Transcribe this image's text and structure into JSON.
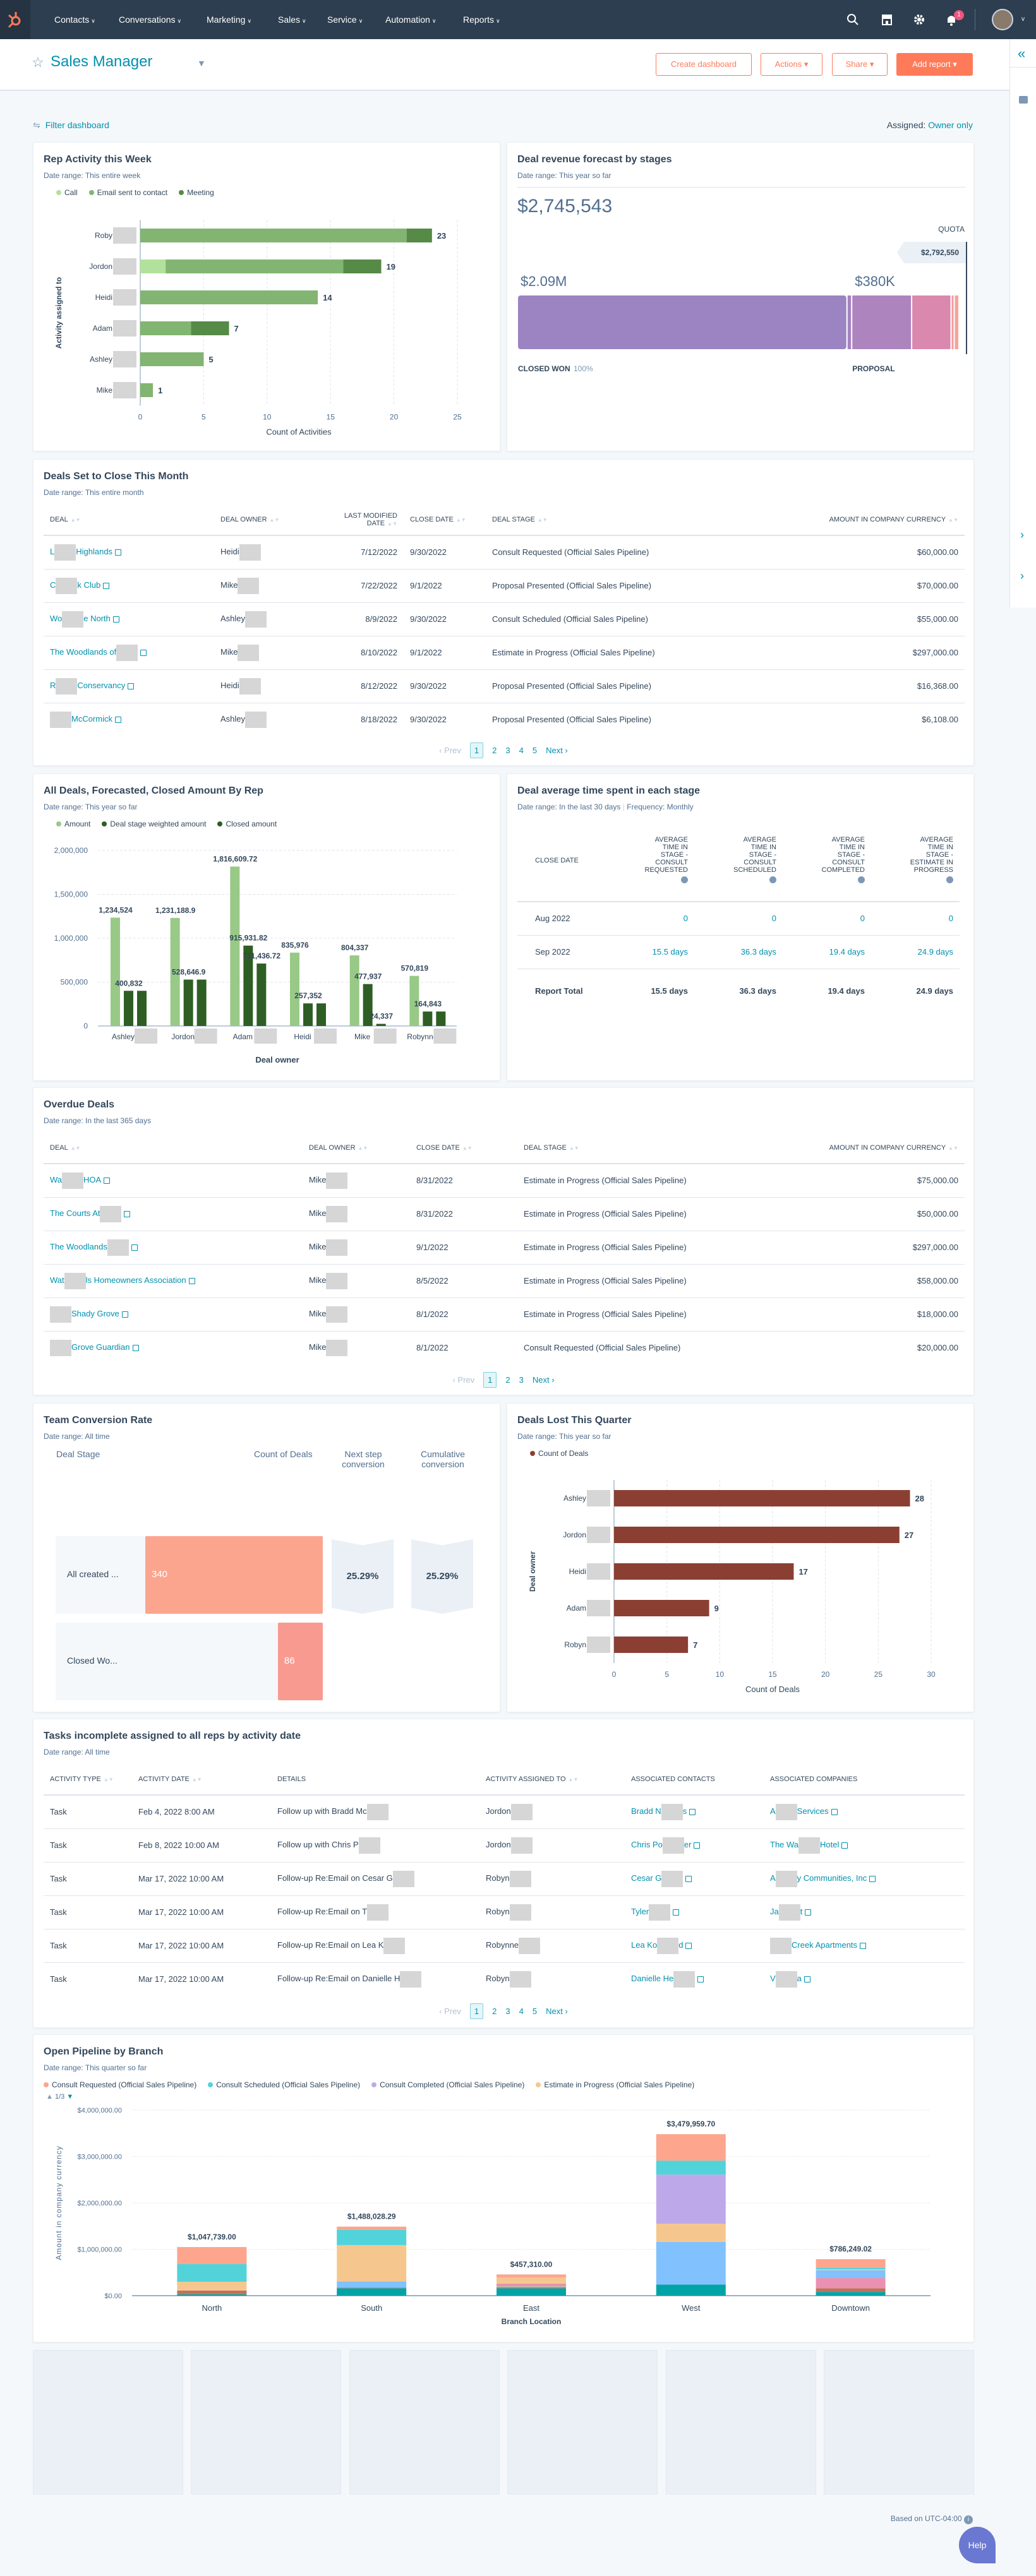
{
  "nav": {
    "items": [
      "Contacts",
      "Conversations",
      "Marketing",
      "Sales",
      "Service",
      "Automation",
      "Reports"
    ],
    "notification_count": "1",
    "icons": [
      "search-icon",
      "marketplace-icon",
      "gear-icon",
      "bell-icon",
      "avatar"
    ]
  },
  "header": {
    "title": "Sales Manager",
    "create_dashboard": "Create dashboard",
    "actions": "Actions",
    "share": "Share",
    "add_report": "Add report"
  },
  "filter": {
    "label": "Filter dashboard",
    "assigned_label": "Assigned:",
    "assigned_value": "Owner only"
  },
  "colors": {
    "nav": "#2d3e50",
    "accent": "#0091ae",
    "button": "#ff7a59"
  },
  "chart_data": [
    {
      "type": "bar",
      "orientation": "horizontal",
      "stacked": true,
      "title": "Rep Activity this Week",
      "subtitle": "Date range: This entire week",
      "categories": [
        "Roby",
        "Jordon",
        "Heidi",
        "Adam",
        "Ashley",
        "Mike"
      ],
      "series": [
        {
          "name": "Call",
          "color": "#b2e19b",
          "values": [
            0,
            2,
            0,
            0,
            0,
            0
          ]
        },
        {
          "name": "Email sent to contact",
          "color": "#82b571",
          "values": [
            21,
            14,
            14,
            4,
            5,
            1
          ]
        },
        {
          "name": "Meeting",
          "color": "#568a47",
          "values": [
            2,
            3,
            0,
            3,
            0,
            0
          ]
        }
      ],
      "totals": [
        "23",
        "19",
        "14",
        "7",
        "5",
        "1"
      ],
      "xlabel": "Count of Activities",
      "ylabel": "Activity assigned to",
      "xlim": [
        0,
        25
      ],
      "xticks": [
        "0",
        "5",
        "10",
        "15",
        "20",
        "25"
      ],
      "grid": true,
      "legend": "top-left"
    },
    {
      "type": "bar",
      "orientation": "vertical",
      "title": "All Deals, Forecasted, Closed Amount By Rep",
      "subtitle": "Date range: This year so far",
      "categories": [
        "Ashley",
        "Jordon",
        "Adam",
        "Heidi",
        "Mike",
        "Robynne"
      ],
      "series": [
        {
          "name": "Amount",
          "color": "#98c987",
          "values": [
            1234524,
            1231188.9,
            1816609.72,
            835976,
            804337,
            570819
          ],
          "labels": [
            "1,234,524",
            "1,231,188.9",
            "1,816,609.72",
            "835,976",
            "804,337",
            "570,819"
          ]
        },
        {
          "name": "Deal stage weighted amount",
          "color": "#2e5e24",
          "values": [
            400832,
            528646.9,
            915931.82,
            257352,
            477937,
            164843
          ],
          "labels": [
            "400,832",
            "528,646.9",
            "915,931.82",
            "257,352",
            "477,937",
            "164,843"
          ]
        },
        {
          "name": "Closed amount",
          "color": "#2e5e24",
          "values": [
            400832,
            528646.9,
            711436.72,
            257352,
            24337,
            164843
          ],
          "labels": [
            "",
            "",
            "711,436.72",
            "",
            "24,337",
            ""
          ]
        }
      ],
      "xlabel": "Deal owner",
      "ylim": [
        0,
        2000000
      ],
      "yticks": [
        "0",
        "500,000",
        "1,000,000",
        "1,500,000",
        "2,000,000"
      ],
      "grid": true,
      "legend": "top-left"
    },
    {
      "type": "bar",
      "orientation": "horizontal",
      "title": "Deals Lost This Quarter",
      "subtitle": "Date range: This year so far",
      "categories": [
        "Ashley",
        "Jordon",
        "Heidi",
        "Adam",
        "Robyn"
      ],
      "series": [
        {
          "name": "Count of Deals",
          "color": "#8b3f33",
          "values": [
            28,
            27,
            17,
            9,
            7
          ]
        }
      ],
      "xlabel": "Count of Deals",
      "ylabel": "Deal owner",
      "xlim": [
        0,
        30
      ],
      "xticks": [
        "0",
        "5",
        "10",
        "15",
        "20",
        "25",
        "30"
      ],
      "grid": true,
      "legend": "top-left"
    },
    {
      "type": "bar",
      "orientation": "vertical",
      "stacked": true,
      "title": "Open Pipeline by Branch",
      "subtitle": "Date range: This quarter so far",
      "legend_page": "1/3",
      "categories": [
        "North",
        "South",
        "East",
        "West",
        "Downtown"
      ],
      "totals": [
        "$1,047,739.00",
        "$1,488,028.29",
        "$457,310.00",
        "$3,479,959.70",
        "$786,249.02"
      ],
      "series": [
        {
          "color": "#00a4a6",
          "values": [
            30000,
            160000,
            160000,
            240000,
            80000
          ]
        },
        {
          "color": "#c2705c",
          "values": [
            80000,
            10000,
            20000,
            0,
            80000
          ]
        },
        {
          "color": "#a2c08c",
          "values": [
            0,
            0,
            20000,
            0,
            0
          ]
        },
        {
          "color": "#ea90b1",
          "values": [
            0,
            0,
            60000,
            0,
            220000
          ]
        },
        {
          "color": "#81c1fd",
          "values": [
            0,
            140000,
            0,
            920000,
            170000
          ]
        },
        {
          "name": "Estimate in Progress (Official Sales Pipeline)",
          "color": "#f5c78e",
          "values": [
            190000,
            780000,
            130000,
            390000,
            20000
          ]
        },
        {
          "name": "Consult Completed (Official Sales Pipeline)",
          "color": "#bda9ea",
          "values": [
            0,
            0,
            0,
            1060000,
            0
          ]
        },
        {
          "name": "Consult Scheduled (Official Sales Pipeline)",
          "color": "#51d3d9",
          "values": [
            380000,
            330000,
            0,
            300000,
            30000
          ]
        },
        {
          "name": "Consult Requested (Official Sales Pipeline)",
          "color": "#fea58e",
          "values": [
            367739,
            68028.29,
            67310,
            569959.7,
            186249.02
          ]
        }
      ],
      "xlabel": "Branch Location",
      "ylabel": "Amount in company currency",
      "ylim": [
        0,
        4000000
      ],
      "yticks": [
        "$0.00",
        "$1,000,000.00",
        "$2,000,000.00",
        "$3,000,000.00",
        "$4,000,000.00"
      ],
      "grid": true,
      "legend": "top-left"
    }
  ],
  "forecast": {
    "title": "Deal revenue forecast by stages",
    "subtitle": "Date range: This year so far",
    "total": "$2,745,543",
    "quota_label": "QUOTA",
    "quota": "$2,792,550",
    "segments": [
      {
        "value": 2090000,
        "color": "#9b84c1",
        "amount": "$2.09M",
        "stage": "CLOSED WON",
        "pct": "100%"
      },
      {
        "value": 30000,
        "color": "#a584c0"
      },
      {
        "value": 380000,
        "color": "#ad84bd",
        "amount": "$380K",
        "stage": "PROPOSAL"
      },
      {
        "value": 250000,
        "color": "#da88ae"
      },
      {
        "value": 20000,
        "color": "#f59a9a"
      },
      {
        "value": 30000,
        "color": "#f8a39a"
      }
    ]
  },
  "deals_close": {
    "title": "Deals Set to Close This Month",
    "subtitle": "Date range: This entire month",
    "headers": [
      "Deal",
      "Deal owner",
      "Last modified date",
      "Close date",
      "Deal stage",
      "Amount in company currency"
    ],
    "rows": [
      [
        {
          "pre": "L",
          "post": "Highlands"
        },
        {
          "pre": "Heidi"
        },
        "7/12/2022",
        "9/30/2022",
        "Consult Requested (Official Sales Pipeline)",
        "$60,000.00"
      ],
      [
        {
          "pre": "C",
          "post": "k Club"
        },
        {
          "pre": "Mike"
        },
        "7/22/2022",
        "9/1/2022",
        "Proposal Presented (Official Sales Pipeline)",
        "$70,000.00"
      ],
      [
        {
          "pre": "Wo",
          "post": "e North"
        },
        {
          "pre": "Ashley"
        },
        "8/9/2022",
        "9/30/2022",
        "Consult Scheduled (Official Sales Pipeline)",
        "$55,000.00"
      ],
      [
        {
          "pre": "The Woodlands of",
          "post": ""
        },
        {
          "pre": "Mike"
        },
        "8/10/2022",
        "9/1/2022",
        "Estimate in Progress (Official Sales Pipeline)",
        "$297,000.00"
      ],
      [
        {
          "pre": "R",
          "post": "Conservancy"
        },
        {
          "pre": "Heidi"
        },
        "8/12/2022",
        "9/30/2022",
        "Proposal Presented (Official Sales Pipeline)",
        "$16,368.00"
      ],
      [
        {
          "pre": "",
          "post": "McCormick"
        },
        {
          "pre": "Ashley"
        },
        "8/18/2022",
        "9/30/2022",
        "Proposal Presented (Official Sales Pipeline)",
        "$6,108.00"
      ]
    ],
    "pager": {
      "prev": "Prev",
      "next": "Next",
      "pages": [
        "1",
        "2",
        "3",
        "4",
        "5"
      ]
    }
  },
  "time_in_stage": {
    "title": "Deal average time spent in each stage",
    "subtitle": "Date range: In the last 30 days",
    "frequency": "Frequency: Monthly",
    "headers": [
      "Close date",
      "Average time in stage - consult requested",
      "Average time in stage - consult scheduled",
      "Average time in stage - consult completed",
      "Average time in stage - estimate in progress"
    ],
    "rows": [
      [
        "Aug 2022",
        "0",
        "0",
        "0",
        "0"
      ],
      [
        "Sep 2022",
        "15.5 days",
        "36.3 days",
        "19.4 days",
        "24.9 days"
      ]
    ],
    "total": [
      "Report Total",
      "15.5 days",
      "36.3 days",
      "19.4 days",
      "24.9 days"
    ]
  },
  "overdue": {
    "title": "Overdue Deals",
    "subtitle": "Date range: In the last 365 days",
    "headers": [
      "Deal",
      "Deal owner",
      "Close date",
      "Deal stage",
      "Amount in company currency"
    ],
    "rows": [
      [
        {
          "pre": "Wa",
          "post": "HOA"
        },
        {
          "pre": "Mike"
        },
        "8/31/2022",
        "Estimate in Progress (Official Sales Pipeline)",
        "$75,000.00"
      ],
      [
        {
          "pre": "The Courts At",
          "post": ""
        },
        {
          "pre": "Mike"
        },
        "8/31/2022",
        "Estimate in Progress (Official Sales Pipeline)",
        "$50,000.00"
      ],
      [
        {
          "pre": "The Woodlands",
          "post": ""
        },
        {
          "pre": "Mike"
        },
        "9/1/2022",
        "Estimate in Progress (Official Sales Pipeline)",
        "$297,000.00"
      ],
      [
        {
          "pre": "Wat",
          "post": "ls Homeowners Association"
        },
        {
          "pre": "Mike"
        },
        "8/5/2022",
        "Estimate in Progress (Official Sales Pipeline)",
        "$58,000.00"
      ],
      [
        {
          "pre": "",
          "post": "Shady Grove"
        },
        {
          "pre": "Mike"
        },
        "8/1/2022",
        "Estimate in Progress (Official Sales Pipeline)",
        "$18,000.00"
      ],
      [
        {
          "pre": "",
          "post": "Grove Guardian"
        },
        {
          "pre": "Mike"
        },
        "8/1/2022",
        "Consult Requested (Official Sales Pipeline)",
        "$20,000.00"
      ]
    ],
    "pager": {
      "prev": "Prev",
      "next": "Next",
      "pages": [
        "1",
        "2",
        "3"
      ]
    }
  },
  "conversion": {
    "title": "Team Conversion Rate",
    "subtitle": "Date range: All time",
    "headers": [
      "Deal Stage",
      "Count of Deals",
      "Next step conversion",
      "Cumulative conversion"
    ],
    "stages": [
      {
        "label": "All created ...",
        "count": 340,
        "count_label": "340",
        "color": "#fca58e"
      },
      {
        "label": "Closed Wo...",
        "count": 86,
        "count_label": "86",
        "color": "#f99a91"
      }
    ],
    "next_step": "25.29%",
    "cumulative": "25.29%"
  },
  "tasks": {
    "title": "Tasks incomplete assigned to all reps by activity date",
    "subtitle": "Date range: All time",
    "headers": [
      "Activity type",
      "Activity date",
      "Details",
      "Activity assigned to",
      "Associated contacts",
      "Associated companies"
    ],
    "rows": [
      [
        "Task",
        "Feb 4, 2022 8:00 AM",
        {
          "pre": "Follow up with Bradd Mc"
        },
        {
          "pre": "Jordon"
        },
        {
          "pre": "Bradd N",
          "post": "s"
        },
        {
          "pre": "A",
          "post": "Services"
        }
      ],
      [
        "Task",
        "Feb 8, 2022 10:00 AM",
        {
          "pre": "Follow up with Chris P"
        },
        {
          "pre": "Jordon"
        },
        {
          "pre": "Chris Po",
          "post": "er"
        },
        {
          "pre": "The Wa",
          "post": "Hotel"
        }
      ],
      [
        "Task",
        "Mar 17, 2022 10:00 AM",
        {
          "pre": "Follow-up Re:Email on Cesar G"
        },
        {
          "pre": "Robyn"
        },
        {
          "pre": "Cesar G",
          "post": ""
        },
        {
          "pre": "A",
          "post": "y Communities, Inc"
        }
      ],
      [
        "Task",
        "Mar 17, 2022 10:00 AM",
        {
          "pre": "Follow-up Re:Email on T"
        },
        {
          "pre": "Robyn"
        },
        {
          "pre": "Tyler"
        },
        {
          "pre": "Ja",
          "post": "t"
        }
      ],
      [
        "Task",
        "Mar 17, 2022 10:00 AM",
        {
          "pre": "Follow-up Re:Email on Lea K"
        },
        {
          "pre": "Robynne"
        },
        {
          "pre": "Lea Ko",
          "post": "d"
        },
        {
          "pre": "",
          "post": "Creek Apartments"
        }
      ],
      [
        "Task",
        "Mar 17, 2022 10:00 AM",
        {
          "pre": "Follow-up Re:Email on Danielle H"
        },
        {
          "pre": "Robyn"
        },
        {
          "pre": "Danielle He",
          "post": ""
        },
        {
          "pre": "V",
          "post": "a"
        }
      ]
    ],
    "pager": {
      "prev": "Prev",
      "next": "Next",
      "pages": [
        "1",
        "2",
        "3",
        "4",
        "5"
      ]
    }
  },
  "footer": {
    "timezone": "Based on UTC-04:00",
    "help": "Help"
  }
}
